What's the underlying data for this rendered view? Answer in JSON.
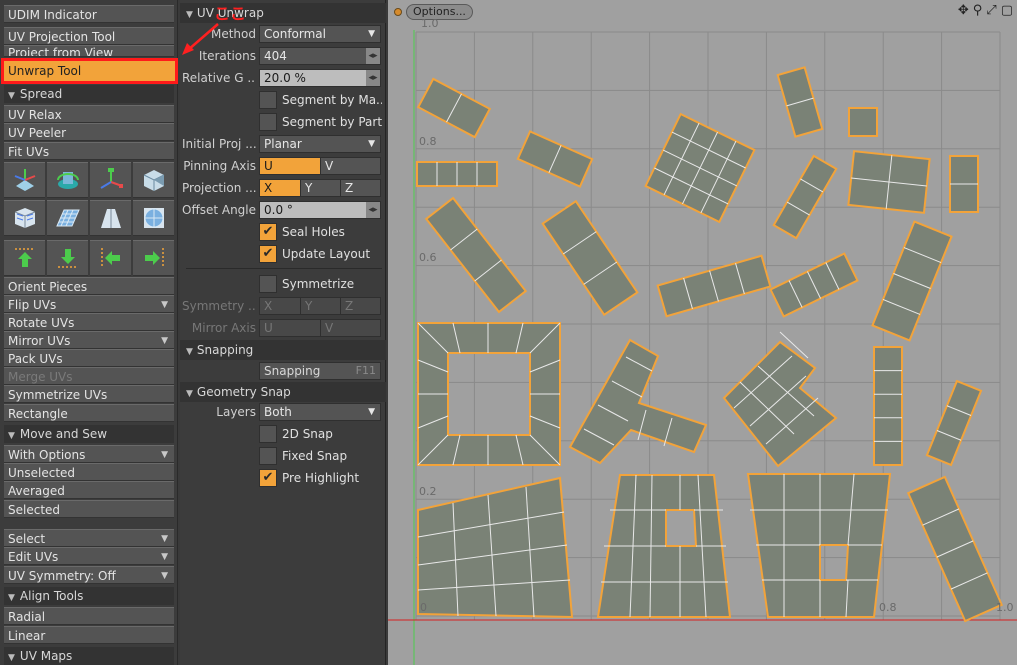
{
  "left_panel": {
    "top_items": [
      "UDIM Indicator",
      "UV Projection Tool",
      "Project from View"
    ],
    "active_tool": "Unwrap Tool",
    "spread_header": "Spread",
    "spread_items": [
      "UV Relax",
      "UV Peeler",
      "Fit UVs"
    ],
    "tools_items": [
      {
        "label": "Orient Pieces",
        "dropdown": false,
        "dim": false
      },
      {
        "label": "Flip UVs",
        "dropdown": true,
        "dim": false
      },
      {
        "label": "Rotate UVs",
        "dropdown": false,
        "dim": false
      },
      {
        "label": "Mirror UVs",
        "dropdown": true,
        "dim": false
      },
      {
        "label": "Pack UVs",
        "dropdown": false,
        "dim": false
      },
      {
        "label": "Merge UVs",
        "dropdown": false,
        "dim": true
      },
      {
        "label": "Symmetrize UVs",
        "dropdown": false,
        "dim": false
      },
      {
        "label": "Rectangle",
        "dropdown": false,
        "dim": false
      }
    ],
    "move_sew_header": "Move and Sew",
    "move_sew_items": [
      {
        "label": "With Options",
        "dropdown": true
      },
      {
        "label": "Unselected",
        "dropdown": false
      },
      {
        "label": "Averaged",
        "dropdown": false
      },
      {
        "label": "Selected",
        "dropdown": false
      }
    ],
    "select_items": [
      {
        "label": "Select",
        "dropdown": true
      },
      {
        "label": "Edit UVs",
        "dropdown": true
      },
      {
        "label": "UV Symmetry: Off",
        "dropdown": true
      }
    ],
    "align_header": "Align Tools",
    "align_items": [
      "Radial",
      "Linear"
    ],
    "uvmaps_header": "UV Maps"
  },
  "mid_panel": {
    "header": "UV Unwrap",
    "method_label": "Method",
    "method_value": "Conformal",
    "iterations_label": "Iterations",
    "iterations_value": "404",
    "relative_label": "Relative G ...",
    "relative_value": "20.0 %",
    "segment_material": "Segment by Ma...",
    "segment_part": "Segment by Part",
    "initial_proj_label": "Initial Proj ...",
    "initial_proj_value": "Planar",
    "pinning_label": "Pinning Axis",
    "pinning_u": "U",
    "pinning_v": "V",
    "projection_label": "Projection ...",
    "proj_x": "X",
    "proj_y": "Y",
    "proj_z": "Z",
    "offset_label": "Offset Angle",
    "offset_value": "0.0 °",
    "seal_holes": "Seal Holes",
    "update_layout": "Update Layout",
    "symmetrize": "Symmetrize",
    "symmetry_label": "Symmetry ...",
    "sym_x": "X",
    "sym_y": "Y",
    "sym_z": "Z",
    "mirror_label": "Mirror Axis",
    "mirror_u": "U",
    "mirror_v": "V",
    "snapping_header": "Snapping",
    "snapping_value": "Snapping",
    "snapping_hotkey": "F11",
    "geometry_snap_header": "Geometry Snap",
    "layers_label": "Layers",
    "layers_value": "Both",
    "snap_2d": "2D Snap",
    "fixed_snap": "Fixed Snap",
    "pre_highlight": "Pre Highlight"
  },
  "viewport": {
    "options_label": "Options...",
    "y_labels": [
      "1.0",
      "0.8",
      "0.6",
      "0.2"
    ],
    "x_labels": [
      "0",
      "0.8",
      "1.0"
    ]
  },
  "annotation": {
    "text": "ここ"
  }
}
